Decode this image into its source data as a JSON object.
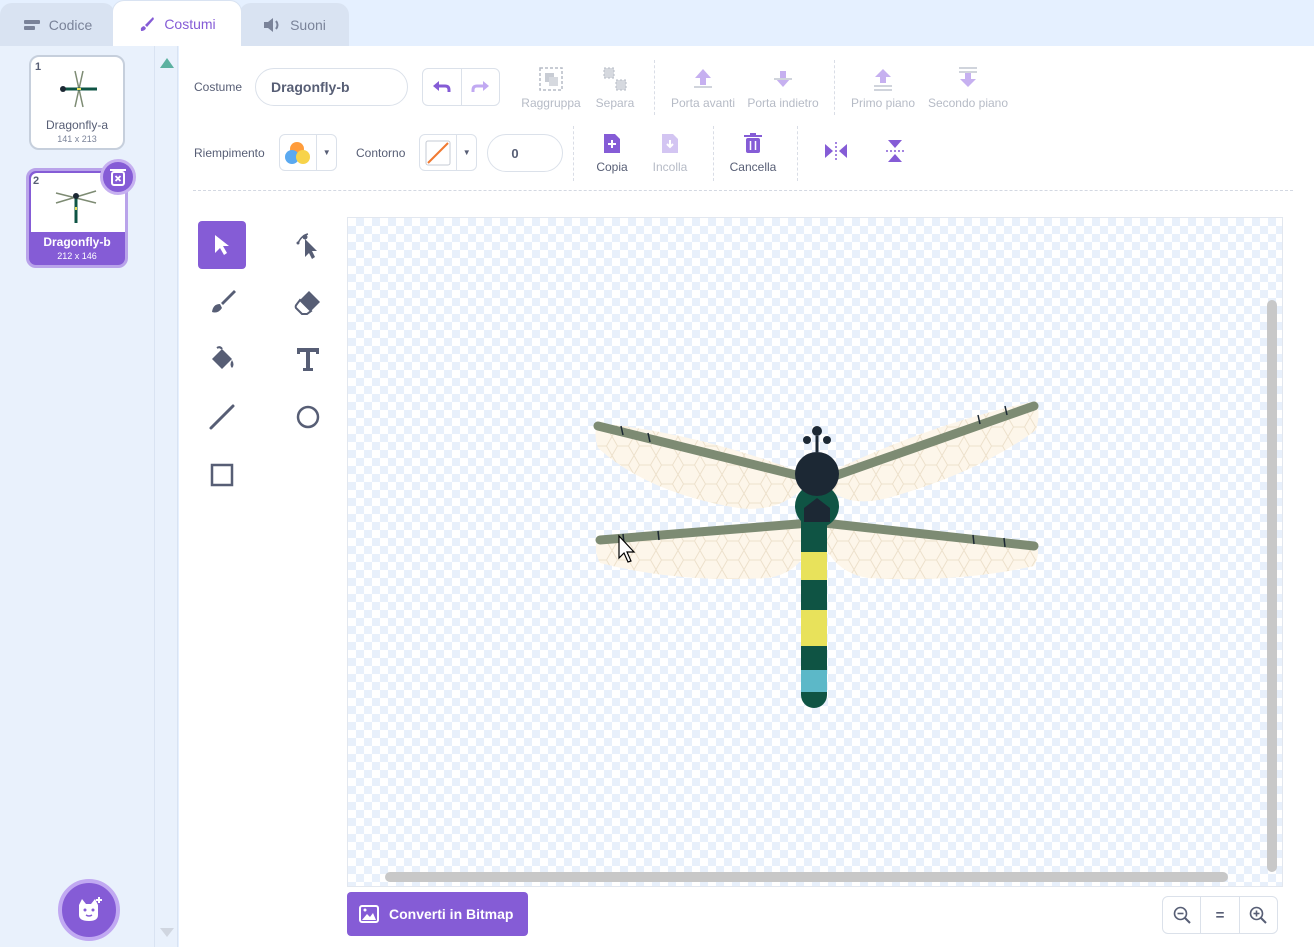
{
  "tabs": [
    {
      "label": "Codice",
      "icon": "code-icon"
    },
    {
      "label": "Costumi",
      "icon": "brush-icon",
      "active": true
    },
    {
      "label": "Suoni",
      "icon": "speaker-icon"
    }
  ],
  "costumes": [
    {
      "number": "1",
      "name": "Dragonfly-a",
      "size": "141 x 213"
    },
    {
      "number": "2",
      "name": "Dragonfly-b",
      "size": "212 x 146",
      "selected": true
    }
  ],
  "toolbar": {
    "costume_label": "Costume",
    "costume_name": "Dragonfly-b",
    "group": "Raggruppa",
    "ungroup": "Separa",
    "forward": "Porta avanti",
    "backward": "Porta indietro",
    "front": "Primo piano",
    "back": "Secondo piano",
    "fill_label": "Riempimento",
    "outline_label": "Contorno",
    "outline_width": "0",
    "copy": "Copia",
    "paste": "Incolla",
    "delete": "Cancella"
  },
  "bottom": {
    "convert_label": "Converti in Bitmap",
    "zoom_reset": "="
  },
  "colors": {
    "accent": "#855cd6",
    "wing_bar": "#7d8b73",
    "wing": "#fdf6ea",
    "body_dark": "#0f5444",
    "body_yellow": "#e8e25b",
    "body_tail": "#5cb8c8",
    "head": "#1c2834"
  }
}
